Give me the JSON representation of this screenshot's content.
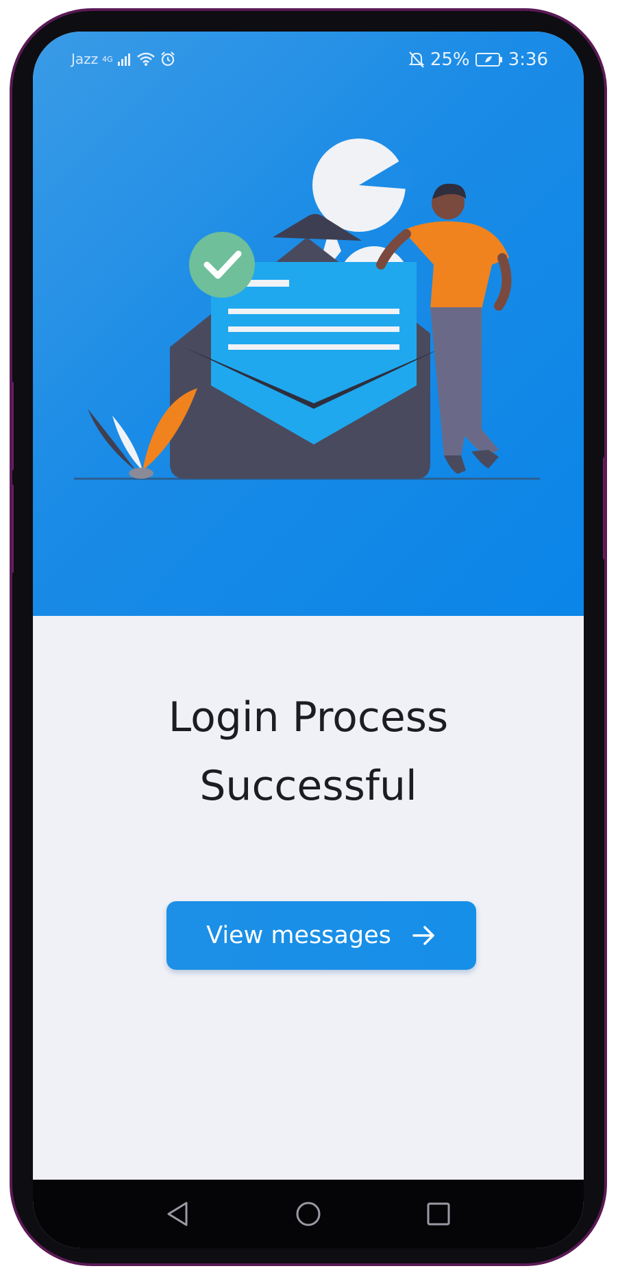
{
  "status_bar": {
    "carrier": "Jazz",
    "network": "4G",
    "battery": "25%",
    "time": "3:36",
    "icons": [
      "signal-icon",
      "wifi-icon",
      "alarm-icon",
      "mute-icon",
      "battery-icon"
    ]
  },
  "hero": {
    "illustration": "email-success-illustration"
  },
  "main": {
    "title_line1": "Login Process",
    "title_line2": "Successful",
    "cta_label": "View messages",
    "cta_icon": "arrow-right-icon"
  },
  "nav_bar": {
    "icons": [
      "back-icon",
      "home-icon",
      "recents-icon"
    ]
  },
  "colors": {
    "primary": "#168FE8",
    "hero_bg": "#1A8BE6",
    "content_bg": "#F0F1F6",
    "accent_orange": "#F0831E",
    "check_green": "#6FBF9A"
  }
}
